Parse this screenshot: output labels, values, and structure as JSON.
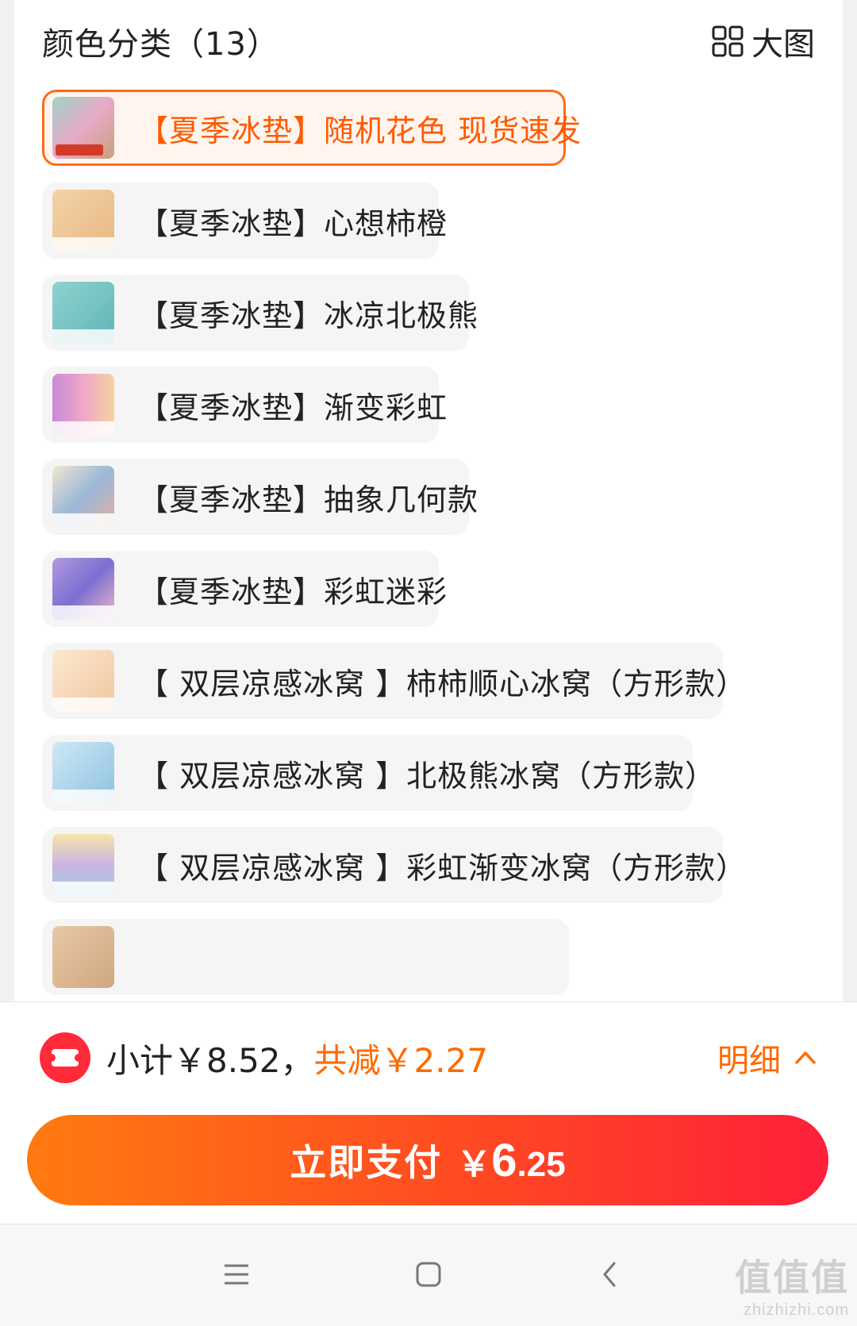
{
  "header": {
    "title": "颜色分类（13）",
    "big_view_label": "大图",
    "big_view_icon": "grid-icon"
  },
  "options": [
    {
      "label": "【夏季冰垫】随机花色 现货速发",
      "selected": true
    },
    {
      "label": "【夏季冰垫】心想柿橙",
      "selected": false
    },
    {
      "label": "【夏季冰垫】冰凉北极熊",
      "selected": false
    },
    {
      "label": "【夏季冰垫】渐变彩虹",
      "selected": false
    },
    {
      "label": "【夏季冰垫】抽象几何款",
      "selected": false
    },
    {
      "label": "【夏季冰垫】彩虹迷彩",
      "selected": false
    },
    {
      "label": "【 双层凉感冰窝 】柿柿顺心冰窝（方形款）",
      "selected": false
    },
    {
      "label": "【 双层凉感冰窝 】北极熊冰窝（方形款）",
      "selected": false
    },
    {
      "label": "【 双层凉感冰窝 】彩虹渐变冰窝（方形款）",
      "selected": false
    }
  ],
  "footer": {
    "coupon_icon": "coupon-icon",
    "subtotal_text": "小计￥8.52，",
    "discount_text": "共减￥2.27",
    "detail_label": "明细",
    "detail_icon": "chevron-up-icon",
    "pay_label": "立即支付",
    "pay_currency": "￥",
    "pay_integer": "6",
    "pay_decimal": ".25"
  },
  "navbar": {
    "menu_icon": "menu-icon",
    "home_icon": "home-icon",
    "back_icon": "back-icon"
  },
  "watermark": {
    "top": "值值值",
    "bottom": "zhizhizhi.com"
  },
  "colors": {
    "accent": "#ff6a00",
    "pay_gradient_start": "#ff7a10",
    "pay_gradient_end": "#ff1f3a",
    "coupon_red": "#ff2a3a"
  }
}
